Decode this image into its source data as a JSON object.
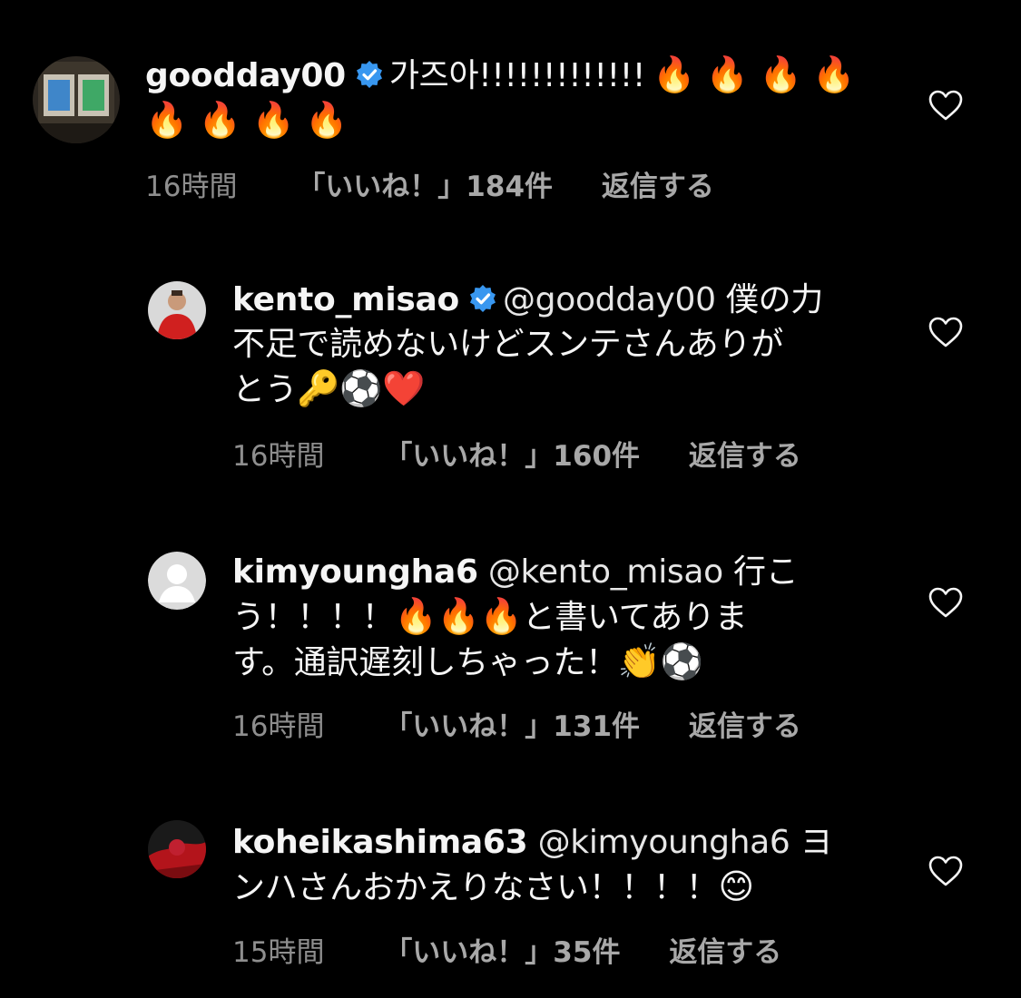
{
  "comments": [
    {
      "username": "goodday00",
      "verified": true,
      "mention": "",
      "text_line1": "가즈아!!!!!!!!!!!!!",
      "emoji_line1": "🔥 🔥 🔥 🔥",
      "emoji_line2": "🔥 🔥 🔥 🔥",
      "time": "16時間",
      "likes": "「いいね！」184件",
      "reply": "返信する"
    },
    {
      "username": "kento_misao",
      "verified": true,
      "mention": "@goodday00",
      "text_line1_tail": "僕の力",
      "text_line2": "不足で読めないけどスンテさんありが",
      "text_line3": "とう",
      "emoji_line3": "🔑⚽❤️",
      "time": "16時間",
      "likes": "「いいね！」160件",
      "reply": "返信する"
    },
    {
      "username": "kimyoungha6",
      "verified": false,
      "mention": "@kento_misao",
      "text_line1_tail": "行こ",
      "text_line2_head": "う！！！！",
      "emoji_line2": "🔥🔥🔥",
      "text_line2_tail": "と書いてありま",
      "text_line3": "す。通訳遅刻しちゃった！",
      "emoji_line3": "👏⚽",
      "time": "16時間",
      "likes": "「いいね！」131件",
      "reply": "返信する"
    },
    {
      "username": "koheikashima63",
      "verified": false,
      "mention": "@kimyoungha6",
      "text_line1_tail": "ヨ",
      "text_line2": "ンハさんおかえりなさい！！！！",
      "emoji_line2": "😊",
      "time": "15時間",
      "likes": "「いいね！」35件",
      "reply": "返信する"
    }
  ],
  "icons": {
    "like": "heart-outline-icon",
    "verified": "verified-badge-icon"
  },
  "colors": {
    "background": "#000000",
    "text": "#f5f5f5",
    "meta": "#8e8e8e",
    "verified": "#3897f0"
  }
}
